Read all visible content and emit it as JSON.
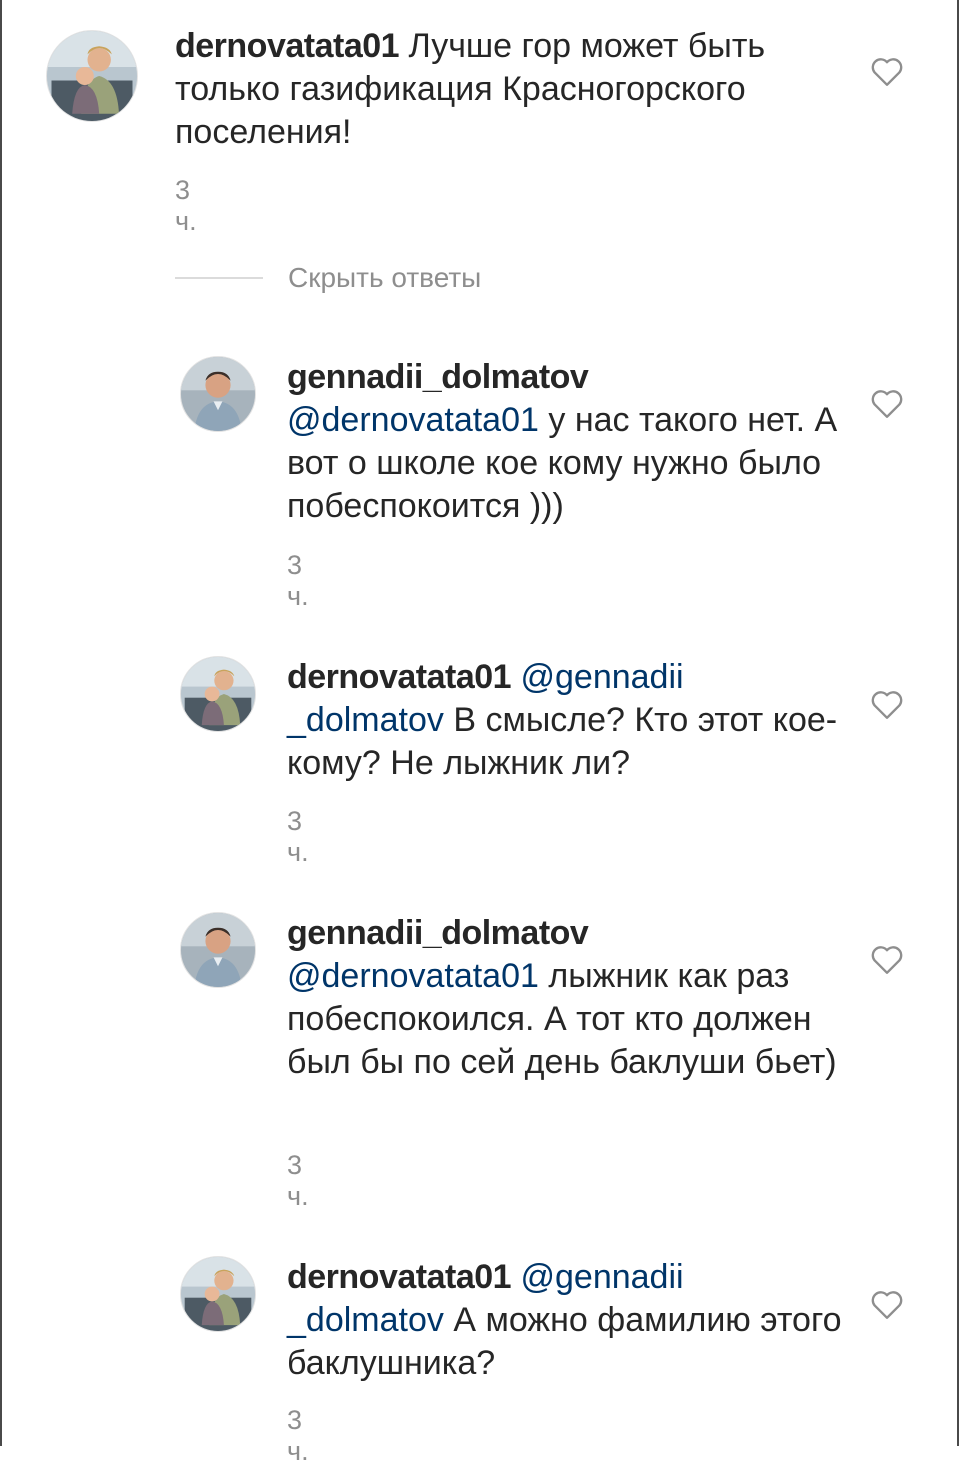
{
  "comments": [
    {
      "username": "dernovatata01",
      "mention": "",
      "text": "Лучше гор может быть только газификация Красногорского поселения!",
      "time": "3 ч.",
      "avatar": "woman-with-child-avatar"
    }
  ],
  "hide_replies_label": "Скрыть ответы",
  "replies": [
    {
      "username": "gennadii_dolmatov",
      "mention": "@dernovatata01",
      "text": "у нас такого нет. А вот о школе кое кому нужно было побеспокоится )))",
      "time": "3 ч.",
      "avatar": "man-avatar"
    },
    {
      "username": "dernovatata01",
      "mention": "@gennadii _dolmatov",
      "text": "В смысле? Кто этот кое-кому? Не лыжник ли?",
      "time": "3 ч.",
      "avatar": "woman-with-child-avatar"
    },
    {
      "username": "gennadii_dolmatov",
      "mention": "@dernovatata01",
      "text": "лыжник как раз побеспокоился. А тот кто должен был бы по сей день баклуши бьет)",
      "time": "3 ч.",
      "avatar": "man-avatar"
    },
    {
      "username": "dernovatata01",
      "mention": "@gennadii _dolmatov",
      "text": "А можно фамилию этого баклушника?",
      "time": "3 ч.",
      "avatar": "woman-with-child-avatar"
    }
  ],
  "colors": {
    "username": "#262626",
    "mention": "#003569",
    "muted": "#8e8e8e",
    "divider": "#dbdbdb"
  },
  "icons": {
    "like": "heart-outline-icon"
  }
}
